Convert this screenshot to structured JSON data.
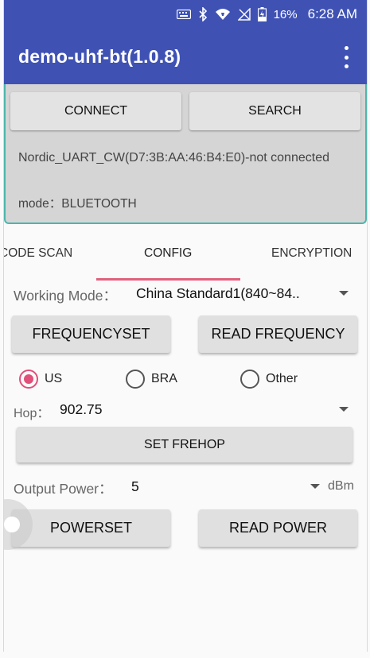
{
  "status_bar": {
    "battery_percent": "16%",
    "time": "6:28 AM",
    "icons": [
      "keyboard-icon",
      "bluetooth-icon",
      "wifi-icon",
      "no-signal-icon",
      "battery-charging-icon"
    ]
  },
  "app_bar": {
    "title": "demo-uhf-bt(1.0.8)",
    "menu_icon": "overflow-menu-icon"
  },
  "connection": {
    "connect_label": "CONNECT",
    "search_label": "SEARCH",
    "device_status": "Nordic_UART_CW(D7:3B:AA:46:B4:E0)-not connected",
    "mode_text": "mode：BLUETOOTH"
  },
  "tabs": {
    "items": [
      "CODE SCAN",
      "CONFIG",
      "ENCRYPTION"
    ],
    "active": "CONFIG"
  },
  "config": {
    "working_mode_label": "Working Mode：",
    "working_mode_value": "China Standard1(840~84..",
    "frequency_set_label": "FREQUENCYSET",
    "read_frequency_label": "READ FREQUENCY",
    "regions": [
      {
        "label": "US",
        "selected": true
      },
      {
        "label": "BRA",
        "selected": false
      },
      {
        "label": "Other",
        "selected": false
      }
    ],
    "hop_label": "Hop：",
    "hop_value": "902.75",
    "set_frehop_label": "SET FREHOP",
    "output_power_label": "Output Power：",
    "output_power_value": "5",
    "power_unit": "dBm",
    "powerset_label": "POWERSET",
    "read_power_label": "READ POWER"
  },
  "colors": {
    "app_bar": "#3f52b4",
    "panel_border": "#4db6ac",
    "accent": "#e0507a"
  }
}
